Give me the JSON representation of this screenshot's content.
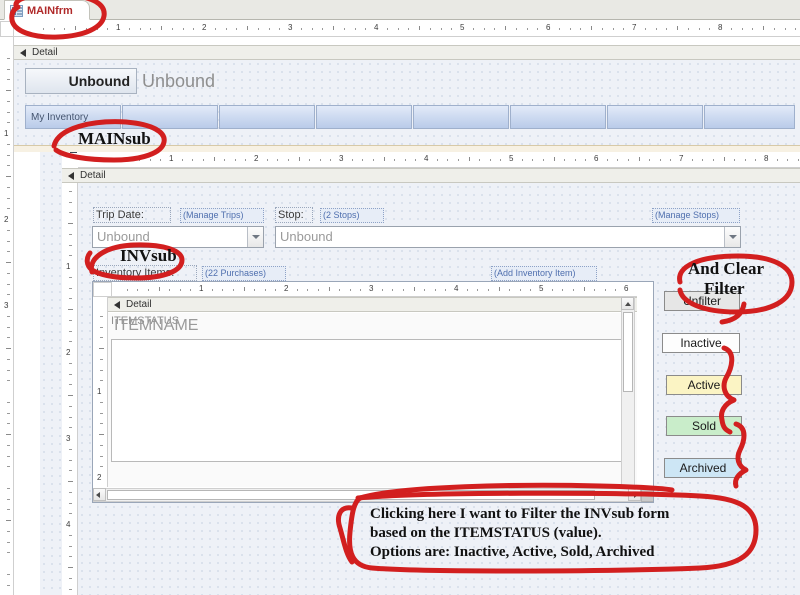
{
  "window": {
    "doc_tab_label": "MAINfrm",
    "doc_tab_icon": "form-design-icon"
  },
  "rulers": {
    "main_horizontal_numbers": [
      "1",
      "2",
      "3",
      "4",
      "5",
      "6",
      "7",
      "8",
      "9"
    ],
    "main_vertical_numbers": [
      "1",
      "2",
      "3"
    ],
    "mainsub_horizontal_numbers": [
      "1",
      "2",
      "3",
      "4",
      "5",
      "6",
      "7",
      "8"
    ],
    "mainsub_vertical_numbers": [
      "1",
      "2",
      "3",
      "4"
    ],
    "invsub_horizontal_numbers": [
      "1",
      "2",
      "3",
      "4",
      "5",
      "6"
    ],
    "invsub_vertical_numbers": [
      "1",
      "2"
    ]
  },
  "mainfrm": {
    "detail_section_label": "Detail",
    "header_button_label": "Unbound",
    "header_title_label": "Unbound",
    "tab_pages": [
      {
        "label": "My Inventory"
      },
      {
        "label": ""
      },
      {
        "label": ""
      },
      {
        "label": ""
      },
      {
        "label": ""
      },
      {
        "label": ""
      },
      {
        "label": ""
      },
      {
        "label": ""
      }
    ]
  },
  "mainsub": {
    "detail_section_label": "Detail",
    "trip_date_label": "Trip Date:",
    "manage_trips_link": "(Manage Trips)",
    "trip_date_value": "Unbound",
    "stop_label": "Stop:",
    "stops_link": "(2 Stops)",
    "manage_stops_link": "(Manage Stops)",
    "stop_value": "Unbound",
    "inventory_items_label": "Inventory Items:",
    "purchases_link": "(22 Purchases)",
    "add_inventory_item_link": "(Add Inventory Item)"
  },
  "invsub": {
    "detail_section_label": "Detail",
    "itemstatus_label": "ITEMSTATUS",
    "itemname_label": "ITEMNAME"
  },
  "filter_panel": {
    "buttons": [
      {
        "label": "Unfilter",
        "bg": "#e6e6e6",
        "border": "#8b8b8b"
      },
      {
        "label": "Inactive",
        "bg": "#fdfdfd",
        "border": "#8b8b8b"
      },
      {
        "label": "Active",
        "bg": "#fbf4c4",
        "border": "#8b8b8b"
      },
      {
        "label": "Sold",
        "bg": "#c9edca",
        "border": "#8b8b8b"
      },
      {
        "label": "Archived",
        "bg": "#cde6f5",
        "border": "#8b8b8b"
      }
    ]
  },
  "annotations": {
    "ink_color": "#d21f1f",
    "mainfrm_tab_note": "MAINfrm",
    "mainsub_note": "MAINsub",
    "invsub_note": "INVsub",
    "clear_filter_note_line1": "And Clear",
    "clear_filter_note_line2": "Filter",
    "bottom_note_line1": "Clicking here I want to Filter the INVsub form",
    "bottom_note_line2": "based on the ITEMSTATUS (value).",
    "bottom_note_line3": "Options are: Inactive, Active, Sold, Archived"
  }
}
